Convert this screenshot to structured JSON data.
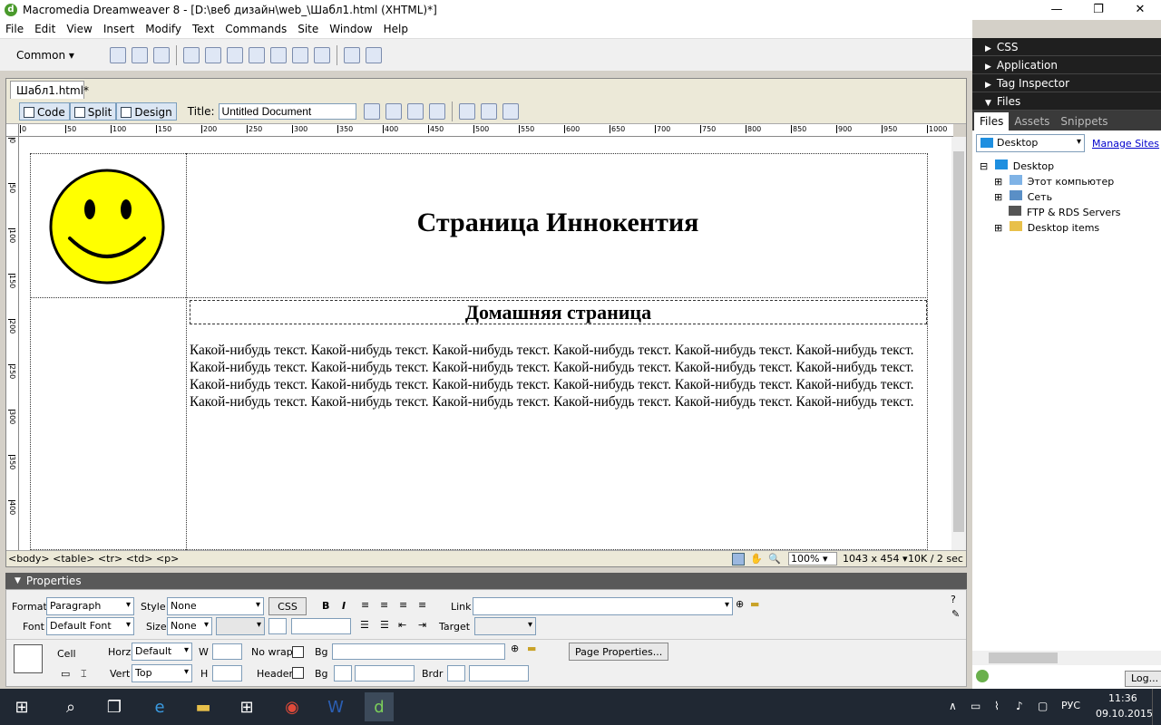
{
  "window": {
    "title": "Macromedia Dreamweaver 8 - [D:\\веб дизайн\\web_\\Шабл1.html (XHTML)*]",
    "minimize": "—",
    "restore": "❐",
    "close": "✕"
  },
  "menu": [
    "File",
    "Edit",
    "View",
    "Insert",
    "Modify",
    "Text",
    "Commands",
    "Site",
    "Window",
    "Help"
  ],
  "insert_bar": {
    "category": "Common"
  },
  "document": {
    "tab": "Шабл1.html*",
    "views": {
      "code": "Code",
      "split": "Split",
      "design": "Design"
    },
    "title_label": "Title:",
    "title_value": "Untitled Document",
    "ruler_h": [
      "0",
      "50",
      "100",
      "150",
      "200",
      "250",
      "300",
      "350",
      "400",
      "450",
      "500",
      "550",
      "600",
      "650",
      "700",
      "750",
      "800",
      "850",
      "900",
      "950",
      "1000"
    ],
    "ruler_v": [
      "0",
      "50",
      "100",
      "150",
      "200",
      "250",
      "300",
      "350",
      "400"
    ]
  },
  "page": {
    "heading": "Страница Иннокентия",
    "subheading": "Домашняя страница",
    "paragraph": "Какой-нибудь текст. Какой-нибудь текст. Какой-нибудь текст. Какой-нибудь текст. Какой-нибудь текст. Какой-нибудь текст. Какой-нибудь текст. Какой-нибудь текст. Какой-нибудь текст. Какой-нибудь текст. Какой-нибудь текст. Какой-нибудь текст. Какой-нибудь текст. Какой-нибудь текст. Какой-нибудь текст. Какой-нибудь текст. Какой-нибудь текст. Какой-нибудь текст. Какой-нибудь текст. Какой-нибудь текст. Какой-нибудь текст. Какой-нибудь текст. Какой-нибудь текст. Какой-нибудь текст.",
    "smiley_fill": "#ffff00"
  },
  "status": {
    "tags": "<body> <table> <tr> <td> <p>",
    "zoom": "100%",
    "size": "1043 x 454",
    "download": "10K / 2 sec"
  },
  "properties": {
    "header": "Properties",
    "format_label": "Format",
    "format_value": "Paragraph",
    "style_label": "Style",
    "style_value": "None",
    "css_btn": "CSS",
    "link_label": "Link",
    "font_label": "Font",
    "font_value": "Default Font",
    "size_label": "Size",
    "size_value": "None",
    "target_label": "Target",
    "cell_label": "Cell",
    "horz_label": "Horz",
    "horz_value": "Default",
    "w_label": "W",
    "nowrap_label": "No wrap",
    "bg_label": "Bg",
    "page_props_btn": "Page Properties...",
    "vert_label": "Vert",
    "vert_value": "Top",
    "h_label": "H",
    "header_label": "Header",
    "bg2_label": "Bg",
    "brdr_label": "Brdr"
  },
  "panels": {
    "css": "CSS",
    "application": "Application",
    "tag_inspector": "Tag Inspector",
    "files": "Files",
    "tabs": [
      "Files",
      "Assets",
      "Snippets"
    ],
    "site_select": "Desktop",
    "manage_sites": "Manage Sites",
    "tree": [
      "Desktop",
      "Этот компьютер",
      "Сеть",
      "FTP & RDS Servers",
      "Desktop items"
    ],
    "log_btn": "Log..."
  },
  "taskbar": {
    "lang": "РУС",
    "time": "11:36",
    "date": "09.10.2015"
  }
}
